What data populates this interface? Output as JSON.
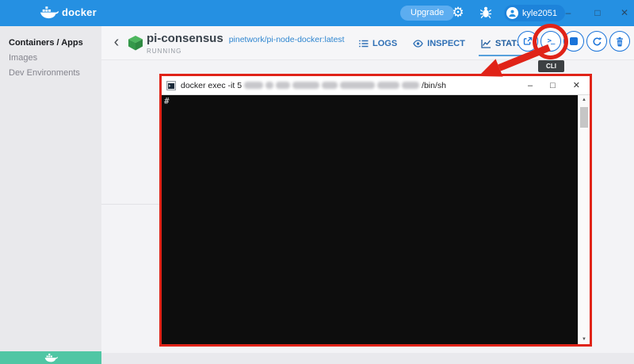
{
  "window": {
    "logo_text": "docker",
    "upgrade_label": "Upgrade",
    "username": "kyle2051",
    "controls": {
      "minimize": "–",
      "maximize": "□",
      "close": "✕"
    }
  },
  "sidebar": {
    "items": [
      {
        "label": "Containers / Apps",
        "active": true
      },
      {
        "label": "Images",
        "active": false
      },
      {
        "label": "Dev Environments",
        "active": false
      }
    ]
  },
  "container": {
    "back_icon": "‹",
    "name": "pi-consensus",
    "image": "pinetwork/pi-node-docker:latest",
    "status": "RUNNING"
  },
  "tabs": [
    {
      "label": "LOGS",
      "active": false
    },
    {
      "label": "INSPECT",
      "active": false
    },
    {
      "label": "STATS",
      "active": true
    }
  ],
  "actions": [
    "open-in-browser",
    "cli",
    "stop",
    "restart",
    "delete"
  ],
  "action_icons": {
    "cli_glyph": ">_"
  },
  "annotations": {
    "tooltip_label": "CLI"
  },
  "terminal": {
    "title_prefix": "docker exec -it 5",
    "title_suffix": "/bin/sh",
    "prompt": "#",
    "controls": {
      "minimize": "–",
      "maximize": "□",
      "close": "✕"
    },
    "scroll": {
      "up": "▲",
      "down": "▼"
    }
  },
  "colors": {
    "header_blue": "#2590e2",
    "accent_blue": "#1a73d9",
    "link_blue": "#2f86d0",
    "annotation_red": "#e02318",
    "teal": "#50c6a4",
    "tooltip_bg": "#3c4043",
    "terminal_bg": "#0d0d0d"
  }
}
